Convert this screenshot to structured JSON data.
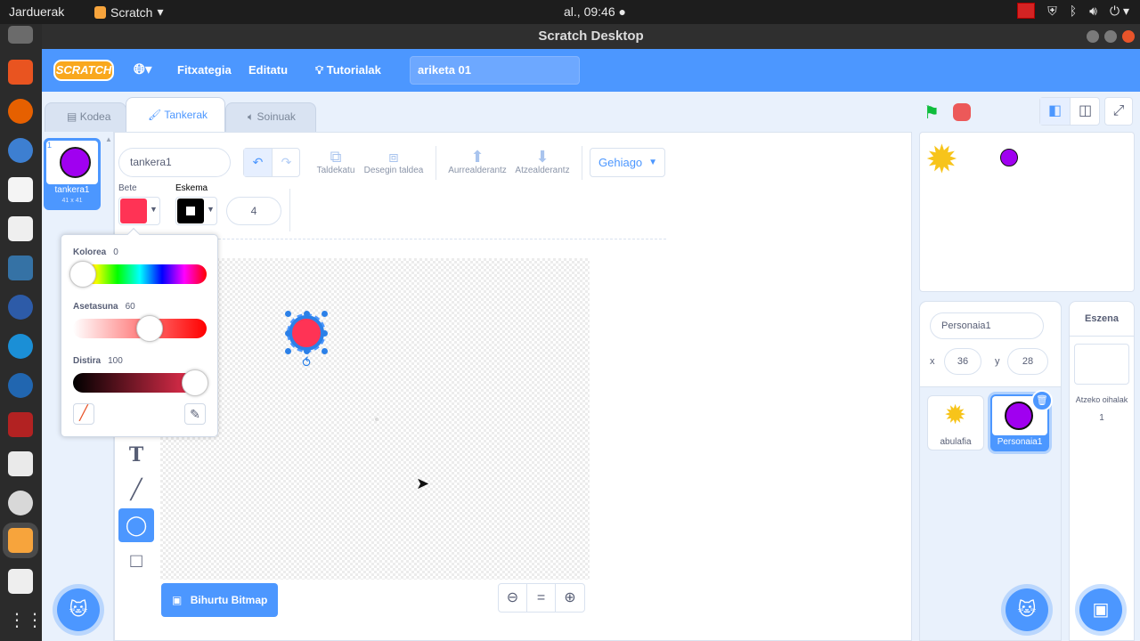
{
  "topbar": {
    "activities": "Jarduerak",
    "app_name": "Scratch",
    "clock": "al., 09:46"
  },
  "window": {
    "title": "Scratch Desktop"
  },
  "menubar": {
    "logo": "SCRATCH",
    "file": "Fitxategia",
    "edit": "Editatu",
    "tutorials": "Tutorialak",
    "project_title": "ariketa 01"
  },
  "tabs": {
    "code": "Kodea",
    "costumes": "Tankerak",
    "sounds": "Soinuak"
  },
  "costume_list": [
    {
      "index": "1",
      "name": "tankera1",
      "size": "41 x 41"
    }
  ],
  "paint_editor": {
    "costume_name": "tankera1",
    "group_label": "Taldekatu",
    "ungroup_label": "Desegin taldea",
    "forward_label": "Aurrealderantz",
    "backward_label": "Atzealderantz",
    "more_label": "Gehiago",
    "fill_label": "Bete",
    "outline_label": "Eskema",
    "outline_width": "4",
    "fill_color": "#ff3355",
    "convert_bitmap": "Bihurtu Bitmap"
  },
  "color_picker": {
    "color_label": "Kolorea",
    "color_value": "0",
    "saturation_label": "Asetasuna",
    "saturation_value": "60",
    "brightness_label": "Distira",
    "brightness_value": "100"
  },
  "sprite_info": {
    "sprite_name": "Personaia1",
    "x_label": "x",
    "x_value": "36",
    "y_label": "y",
    "y_value": "28"
  },
  "sprites": [
    {
      "name": "abulafia"
    },
    {
      "name": "Personaia1"
    }
  ],
  "stage_pane": {
    "title": "Eszena",
    "backdrops_label": "Atzeko oihalak",
    "backdrops_count": "1"
  },
  "colors": {
    "accent": "#4c97ff",
    "sprite_purple": "#a000f0",
    "fill_red": "#ff3355"
  }
}
